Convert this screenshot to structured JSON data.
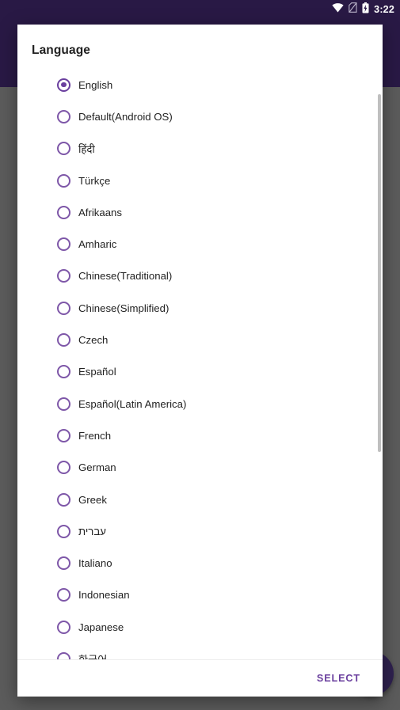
{
  "status_bar": {
    "time": "3:22",
    "icons": [
      {
        "name": "wifi-icon",
        "glyph": "wifi"
      },
      {
        "name": "no-sim-icon",
        "glyph": "no-sim"
      },
      {
        "name": "battery-charging-icon",
        "glyph": "battery-charging"
      }
    ]
  },
  "dialog": {
    "title": "Language",
    "select_label": "SELECT",
    "selected_index": 0,
    "options": [
      {
        "label": "English",
        "selected": true
      },
      {
        "label": "Default(Android OS)",
        "selected": false
      },
      {
        "label": "हिंदी",
        "selected": false
      },
      {
        "label": "Türkçe",
        "selected": false
      },
      {
        "label": "Afrikaans",
        "selected": false
      },
      {
        "label": "Amharic",
        "selected": false
      },
      {
        "label": "Chinese(Traditional)",
        "selected": false
      },
      {
        "label": "Chinese(Simplified)",
        "selected": false
      },
      {
        "label": "Czech",
        "selected": false
      },
      {
        "label": "Español",
        "selected": false
      },
      {
        "label": "Español(Latin America)",
        "selected": false
      },
      {
        "label": "French",
        "selected": false
      },
      {
        "label": "German",
        "selected": false
      },
      {
        "label": "Greek",
        "selected": false
      },
      {
        "label": "עברית",
        "selected": false
      },
      {
        "label": "Italiano",
        "selected": false
      },
      {
        "label": "Indonesian",
        "selected": false
      },
      {
        "label": "Japanese",
        "selected": false
      },
      {
        "label": "한국어",
        "selected": false
      }
    ]
  },
  "colors": {
    "accent_purple": "#6a3f9e",
    "radio_outline": "#7e57a8",
    "app_bar": "#291945",
    "scrim": "#5c5c5c",
    "fab": "#2f2150",
    "dialog_bg": "#ffffff",
    "scrollbar_thumb": "#bfbfbf"
  }
}
